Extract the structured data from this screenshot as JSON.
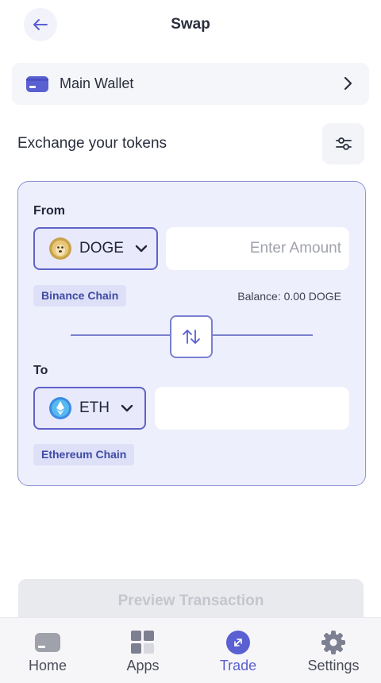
{
  "header": {
    "title": "Swap"
  },
  "wallet": {
    "label": "Main Wallet"
  },
  "subtitle": "Exchange your tokens",
  "from": {
    "section_label": "From",
    "token": "DOGE",
    "amount_placeholder": "Enter Amount",
    "chain": "Binance Chain",
    "balance": "Balance: 0.00 DOGE"
  },
  "to": {
    "section_label": "To",
    "token": "ETH",
    "amount_value": "",
    "chain": "Ethereum Chain"
  },
  "preview_button": "Preview Transaction",
  "nav": {
    "items": [
      {
        "label": "Home",
        "icon": "wallet-icon"
      },
      {
        "label": "Apps",
        "icon": "apps-grid-icon"
      },
      {
        "label": "Trade",
        "icon": "trade-icon",
        "active": true
      },
      {
        "label": "Settings",
        "icon": "gear-icon"
      }
    ]
  },
  "colors": {
    "accent": "#5a5fd1",
    "card_bg": "#eeeffc",
    "card_border": "#8e93d4",
    "badge_bg": "#dde0f7",
    "doge": "#c9a34a",
    "eth": "#3d8ae3"
  }
}
